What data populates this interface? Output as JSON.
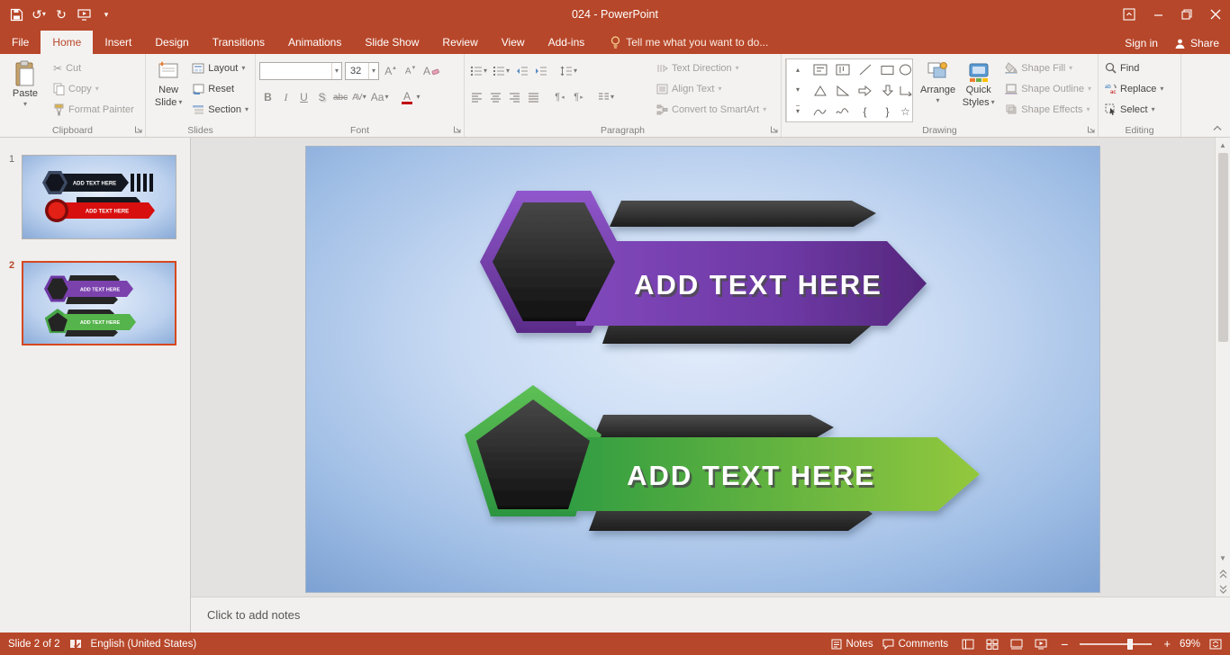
{
  "titlebar": {
    "title": "024 - PowerPoint"
  },
  "nav": {
    "file": "File",
    "tabs": [
      "Home",
      "Insert",
      "Design",
      "Transitions",
      "Animations",
      "Slide Show",
      "Review",
      "View",
      "Add-ins"
    ],
    "tell_me": "Tell me what you want to do...",
    "sign_in": "Sign in",
    "share": "Share"
  },
  "ribbon": {
    "clipboard": {
      "group": "Clipboard",
      "paste": "Paste",
      "cut": "Cut",
      "copy": "Copy",
      "format_painter": "Format Painter"
    },
    "slides": {
      "group": "Slides",
      "new_slide_line1": "New",
      "new_slide_line2": "Slide",
      "layout": "Layout",
      "reset": "Reset",
      "section": "Section"
    },
    "font": {
      "group": "Font",
      "font_size": "32",
      "grow": "A",
      "shrink": "A",
      "clear": "A",
      "bold": "B",
      "italic": "I",
      "underline": "U",
      "shadow": "S",
      "strikethrough": "abc",
      "char_spacing": "AV",
      "change_case": "Aa",
      "font_color": "A"
    },
    "paragraph": {
      "group": "Paragraph",
      "text_direction": "Text Direction",
      "align_text": "Align Text",
      "smartart": "Convert to SmartArt"
    },
    "drawing": {
      "group": "Drawing",
      "arrange": "Arrange",
      "quick_styles_line1": "Quick",
      "quick_styles_line2": "Styles",
      "shape_fill": "Shape Fill",
      "shape_outline": "Shape Outline",
      "shape_effects": "Shape Effects"
    },
    "editing": {
      "group": "Editing",
      "find": "Find",
      "replace": "Replace",
      "select": "Select"
    }
  },
  "slides_panel": {
    "slide1_number": "1",
    "slide2_number": "2"
  },
  "thumbnails": {
    "slide1": {
      "banner1_text": "ADD TEXT HERE",
      "banner2_text": "ADD TEXT HERE"
    },
    "slide2": {
      "banner1_text": "ADD TEXT HERE",
      "banner2_text": "ADD TEXT HERE"
    }
  },
  "slide": {
    "banner_top_text": "ADD TEXT HERE",
    "banner_bottom_text": "ADD TEXT HERE"
  },
  "notes": {
    "placeholder": "Click to add notes"
  },
  "statusbar": {
    "slide_info": "Slide 2 of 2",
    "language": "English (United States)",
    "notes_label": "Notes",
    "comments_label": "Comments",
    "zoom_level": "69%"
  },
  "icons": {
    "dropdown": "▾",
    "cut_scissors": "✂",
    "undo": "↺",
    "redo": "↻",
    "zoom_out": "−",
    "zoom_in": "+",
    "star": "☆",
    "brace_left": "{",
    "brace_right": "}",
    "paragraph_mark": "¶"
  },
  "colors": {
    "accent": "#b7472a",
    "purple_banner": "#6f3aa3",
    "green_banner": "#55b44b",
    "selection": "#d6481f"
  }
}
